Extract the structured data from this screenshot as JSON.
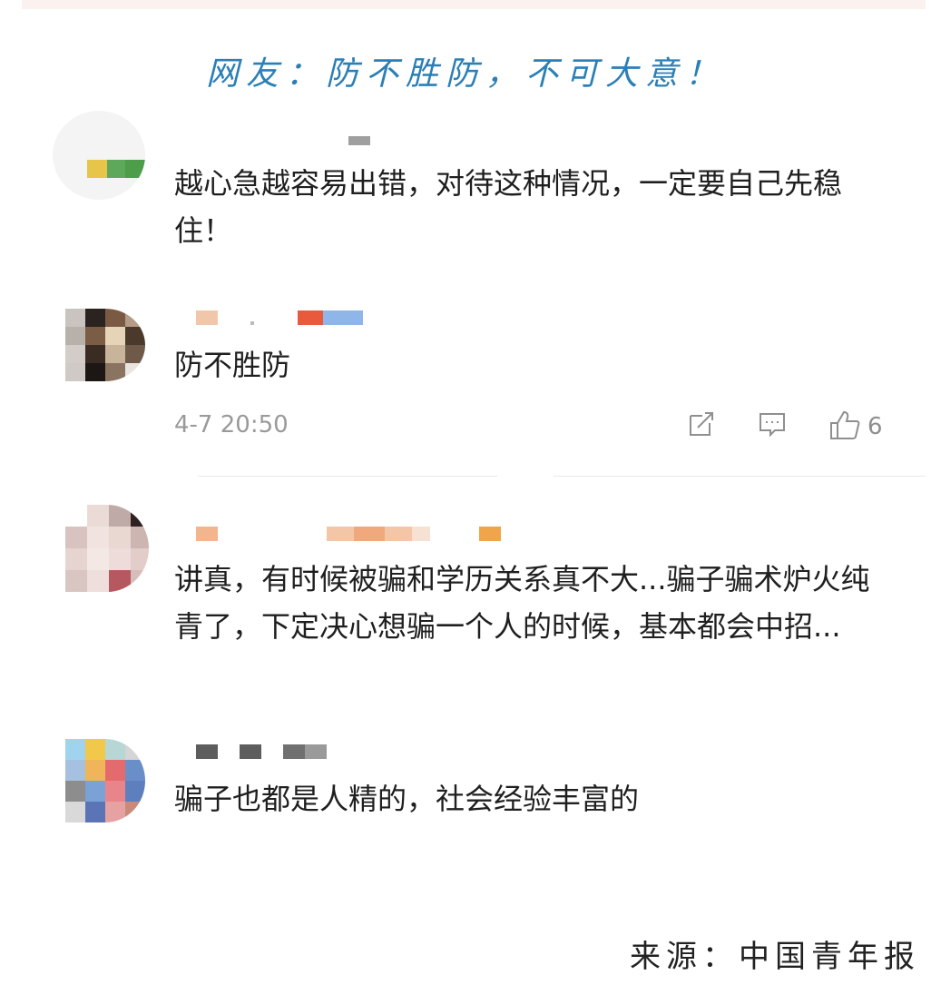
{
  "headline": "网友：防不胜防，不可大意！",
  "comments": [
    {
      "text": "越心急越容易出错，对待这种情况，一定要自己先稳住！"
    },
    {
      "text": "防不胜防",
      "time": "4-7 20:50",
      "likes": "6"
    },
    {
      "text": "讲真，有时候被骗和学历关系真不大...骗子骗术炉火纯青了，下定决心想骗一个人的时候，基本都会中招..."
    },
    {
      "text": "骗子也都是人精的，社会经验丰富的"
    }
  ],
  "icons": {
    "repost": "repost-icon",
    "reply": "comment-icon",
    "like": "thumbs-up-icon"
  },
  "source": "来源：中国青年报",
  "colors": {
    "headline": "#2b7fb6",
    "text": "#1f1f1f",
    "meta": "#9a9a9a"
  }
}
